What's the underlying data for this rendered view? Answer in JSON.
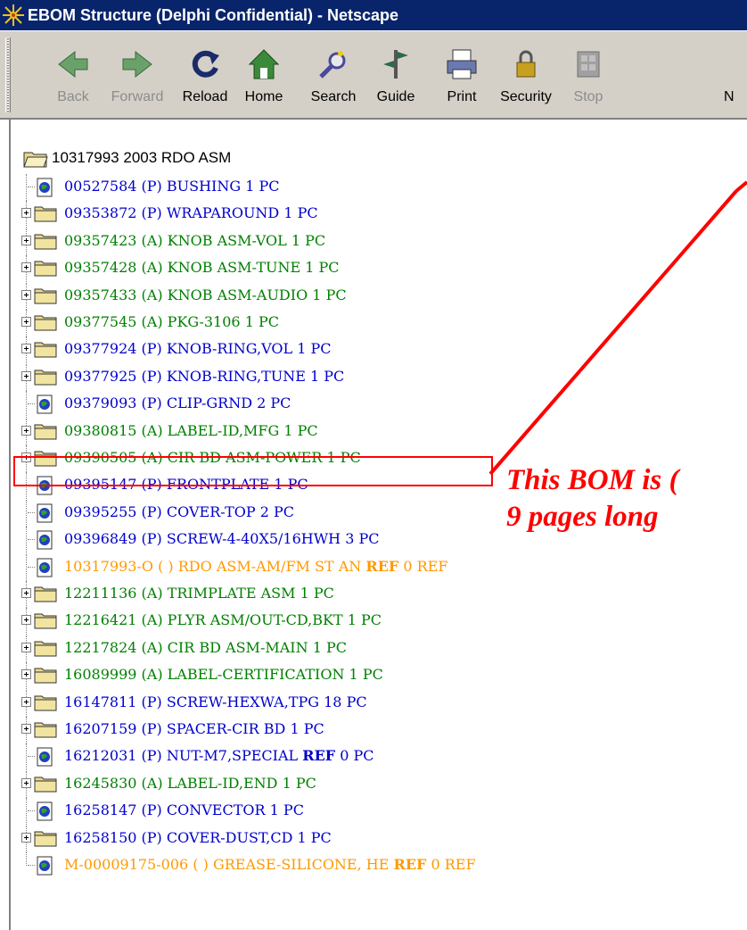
{
  "window": {
    "title": "EBOM Structure (Delphi Confidential) - Netscape",
    "icon": "netscape-icon"
  },
  "toolbar": {
    "buttons": [
      {
        "label": "Back",
        "icon": "back-arrow-icon",
        "enabled": false
      },
      {
        "label": "Forward",
        "icon": "forward-arrow-icon",
        "enabled": false
      },
      {
        "label": "Reload",
        "icon": "reload-icon",
        "enabled": true
      },
      {
        "label": "Home",
        "icon": "home-icon",
        "enabled": true
      },
      {
        "label": "Search",
        "icon": "search-icon",
        "enabled": true
      },
      {
        "label": "Guide",
        "icon": "guide-icon",
        "enabled": true
      },
      {
        "label": "Print",
        "icon": "print-icon",
        "enabled": true
      },
      {
        "label": "Security",
        "icon": "security-lock-icon",
        "enabled": true
      },
      {
        "label": "Stop",
        "icon": "stop-icon",
        "enabled": false
      },
      {
        "label": "N",
        "icon": "netscape-icon",
        "enabled": true
      }
    ]
  },
  "colors": {
    "blue": "#0000cc",
    "green": "#008000",
    "orange": "#ff9900",
    "annotation": "#ff0000",
    "titlebar": "#08246b"
  },
  "tree": {
    "root": {
      "label": "10317993 2003 RDO ASM",
      "icon": "open-folder-icon"
    },
    "items": [
      {
        "part": "00527584",
        "type": "(P)",
        "desc": "BUSHING",
        "qty": "1",
        "unit": "PC",
        "ref": "",
        "color": "blue",
        "kind": "leaf"
      },
      {
        "part": "09353872",
        "type": "(P)",
        "desc": "WRAPAROUND",
        "qty": "1",
        "unit": "PC",
        "ref": "",
        "color": "blue",
        "kind": "folder"
      },
      {
        "part": "09357423",
        "type": "(A)",
        "desc": "KNOB ASM-VOL",
        "qty": "1",
        "unit": "PC",
        "ref": "",
        "color": "green",
        "kind": "folder"
      },
      {
        "part": "09357428",
        "type": "(A)",
        "desc": "KNOB ASM-TUNE",
        "qty": "1",
        "unit": "PC",
        "ref": "",
        "color": "green",
        "kind": "folder"
      },
      {
        "part": "09357433",
        "type": "(A)",
        "desc": "KNOB ASM-AUDIO",
        "qty": "1",
        "unit": "PC",
        "ref": "",
        "color": "green",
        "kind": "folder"
      },
      {
        "part": "09377545",
        "type": "(A)",
        "desc": "PKG-3106",
        "qty": "1",
        "unit": "PC",
        "ref": "",
        "color": "green",
        "kind": "folder"
      },
      {
        "part": "09377924",
        "type": "(P)",
        "desc": "KNOB-RING,VOL",
        "qty": "1",
        "unit": "PC",
        "ref": "",
        "color": "blue",
        "kind": "folder"
      },
      {
        "part": "09377925",
        "type": "(P)",
        "desc": "KNOB-RING,TUNE",
        "qty": "1",
        "unit": "PC",
        "ref": "",
        "color": "blue",
        "kind": "folder"
      },
      {
        "part": "09379093",
        "type": "(P)",
        "desc": "CLIP-GRND",
        "qty": "2",
        "unit": "PC",
        "ref": "",
        "color": "blue",
        "kind": "leaf"
      },
      {
        "part": "09380815",
        "type": "(A)",
        "desc": "LABEL-ID,MFG",
        "qty": "1",
        "unit": "PC",
        "ref": "",
        "color": "green",
        "kind": "folder"
      },
      {
        "part": "09390505",
        "type": "(A)",
        "desc": "CIR BD ASM-POWER",
        "qty": "1",
        "unit": "PC",
        "ref": "",
        "color": "green",
        "kind": "folder"
      },
      {
        "part": "09395147",
        "type": "(P)",
        "desc": "FRONTPLATE",
        "qty": "1",
        "unit": "PC",
        "ref": "",
        "color": "blue",
        "kind": "leaf"
      },
      {
        "part": "09395255",
        "type": "(P)",
        "desc": "COVER-TOP",
        "qty": "2",
        "unit": "PC",
        "ref": "",
        "color": "blue",
        "kind": "leaf"
      },
      {
        "part": "09396849",
        "type": "(P)",
        "desc": "SCREW-4-40X5/16HWH",
        "qty": "3",
        "unit": "PC",
        "ref": "",
        "color": "blue",
        "kind": "leaf"
      },
      {
        "part": "10317993-O",
        "type": "( )",
        "desc": "RDO ASM-AM/FM ST AN",
        "qty": "0",
        "unit": "REF",
        "ref": "REF",
        "color": "orange",
        "kind": "leaf"
      },
      {
        "part": "12211136",
        "type": "(A)",
        "desc": "TRIMPLATE ASM",
        "qty": "1",
        "unit": "PC",
        "ref": "",
        "color": "green",
        "kind": "folder"
      },
      {
        "part": "12216421",
        "type": "(A)",
        "desc": "PLYR ASM/OUT-CD,BKT",
        "qty": "1",
        "unit": "PC",
        "ref": "",
        "color": "green",
        "kind": "folder"
      },
      {
        "part": "12217824",
        "type": "(A)",
        "desc": "CIR BD ASM-MAIN",
        "qty": "1",
        "unit": "PC",
        "ref": "",
        "color": "green",
        "kind": "folder"
      },
      {
        "part": "16089999",
        "type": "(A)",
        "desc": "LABEL-CERTIFICATION",
        "qty": "1",
        "unit": "PC",
        "ref": "",
        "color": "green",
        "kind": "folder"
      },
      {
        "part": "16147811",
        "type": "(P)",
        "desc": "SCREW-HEXWA,TPG",
        "qty": "18",
        "unit": "PC",
        "ref": "",
        "color": "blue",
        "kind": "folder"
      },
      {
        "part": "16207159",
        "type": "(P)",
        "desc": "SPACER-CIR BD",
        "qty": "1",
        "unit": "PC",
        "ref": "",
        "color": "blue",
        "kind": "folder"
      },
      {
        "part": "16212031",
        "type": "(P)",
        "desc": "NUT-M7,SPECIAL",
        "qty": "0",
        "unit": "PC",
        "ref": "REF",
        "color": "blue",
        "kind": "leaf"
      },
      {
        "part": "16245830",
        "type": "(A)",
        "desc": "LABEL-ID,END",
        "qty": "1",
        "unit": "PC",
        "ref": "",
        "color": "green",
        "kind": "folder"
      },
      {
        "part": "16258147",
        "type": "(P)",
        "desc": "CONVECTOR",
        "qty": "1",
        "unit": "PC",
        "ref": "",
        "color": "blue",
        "kind": "leaf"
      },
      {
        "part": "16258150",
        "type": "(P)",
        "desc": "COVER-DUST,CD",
        "qty": "1",
        "unit": "PC",
        "ref": "",
        "color": "blue",
        "kind": "folder"
      },
      {
        "part": "M-00009175-006",
        "type": "( )",
        "desc": "GREASE-SILICONE, HE",
        "qty": "0",
        "unit": "REF",
        "ref": "REF",
        "color": "orange",
        "kind": "leaf"
      }
    ]
  },
  "annotation": {
    "line1": "This BOM is (",
    "line2": "9 pages long",
    "highlighted_part": "09390505"
  }
}
